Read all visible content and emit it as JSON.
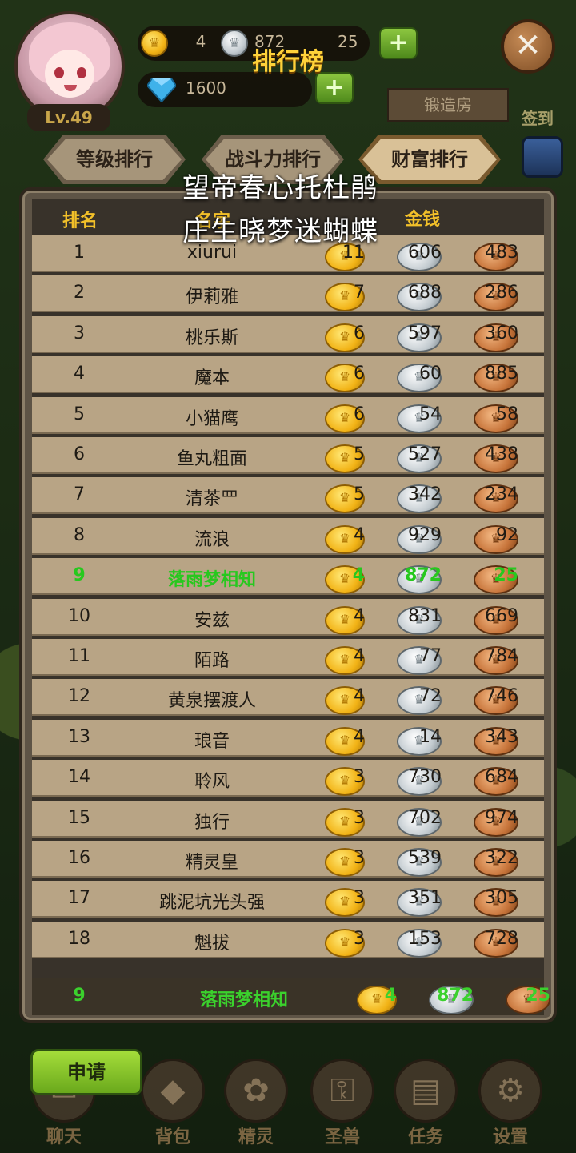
{
  "header": {
    "title": "排行榜",
    "level": "Lv.49",
    "resources": {
      "gold": "4",
      "silver": "872",
      "bronze": "25",
      "diamond": "1600"
    },
    "plus_label": "+",
    "close_label": "✕",
    "forge_label": "锻造房",
    "checkin_label": "签到"
  },
  "tabs": [
    {
      "label": "等级排行",
      "active": false
    },
    {
      "label": "战斗力排行",
      "active": false
    },
    {
      "label": "财富排行",
      "active": true
    }
  ],
  "table": {
    "columns": {
      "rank": "排名",
      "name": "名字",
      "money": "金钱"
    },
    "rows": [
      {
        "rank": "1",
        "name": "xiurui",
        "gold": "11",
        "silver": "606",
        "bronze": "483"
      },
      {
        "rank": "2",
        "name": "伊莉雅",
        "gold": "7",
        "silver": "688",
        "bronze": "286"
      },
      {
        "rank": "3",
        "name": "桃乐斯",
        "gold": "6",
        "silver": "597",
        "bronze": "360"
      },
      {
        "rank": "4",
        "name": "魔本",
        "gold": "6",
        "silver": "60",
        "bronze": "885"
      },
      {
        "rank": "5",
        "name": "小猫鹰",
        "gold": "6",
        "silver": "54",
        "bronze": "58"
      },
      {
        "rank": "6",
        "name": "鱼丸粗面",
        "gold": "5",
        "silver": "527",
        "bronze": "438"
      },
      {
        "rank": "7",
        "name": "清茶罒",
        "gold": "5",
        "silver": "342",
        "bronze": "234"
      },
      {
        "rank": "8",
        "name": "流浪",
        "gold": "4",
        "silver": "929",
        "bronze": "92"
      },
      {
        "rank": "9",
        "name": "落雨梦相知",
        "gold": "4",
        "silver": "872",
        "bronze": "25",
        "me": true
      },
      {
        "rank": "10",
        "name": "安兹",
        "gold": "4",
        "silver": "831",
        "bronze": "669"
      },
      {
        "rank": "11",
        "name": "陌路",
        "gold": "4",
        "silver": "77",
        "bronze": "784"
      },
      {
        "rank": "12",
        "name": "黄泉摆渡人",
        "gold": "4",
        "silver": "72",
        "bronze": "746"
      },
      {
        "rank": "13",
        "name": "琅音",
        "gold": "4",
        "silver": "14",
        "bronze": "343"
      },
      {
        "rank": "14",
        "name": "聆风",
        "gold": "3",
        "silver": "730",
        "bronze": "684"
      },
      {
        "rank": "15",
        "name": "独行",
        "gold": "3",
        "silver": "702",
        "bronze": "974"
      },
      {
        "rank": "16",
        "name": "精灵皇",
        "gold": "3",
        "silver": "539",
        "bronze": "322"
      },
      {
        "rank": "17",
        "name": "跳泥坑光头强",
        "gold": "3",
        "silver": "351",
        "bronze": "305"
      },
      {
        "rank": "18",
        "name": "魁拔",
        "gold": "3",
        "silver": "153",
        "bronze": "728"
      }
    ],
    "my_row": {
      "rank": "9",
      "name": "落雨梦相知",
      "gold": "4",
      "silver": "872",
      "bronze": "25"
    }
  },
  "overlay_text": {
    "line1": "望帝春心托杜鹃",
    "line2": "庄生晓梦迷蝴蝶"
  },
  "apply_button": "申请",
  "nav": {
    "chat": "聊天",
    "bag": "背包",
    "spirit": "精灵",
    "beast": "圣兽",
    "task": "任务",
    "settings": "设置"
  },
  "colors": {
    "highlight": "#27c81e",
    "header_gold": "#f2c029",
    "title": "#ffd23a"
  }
}
